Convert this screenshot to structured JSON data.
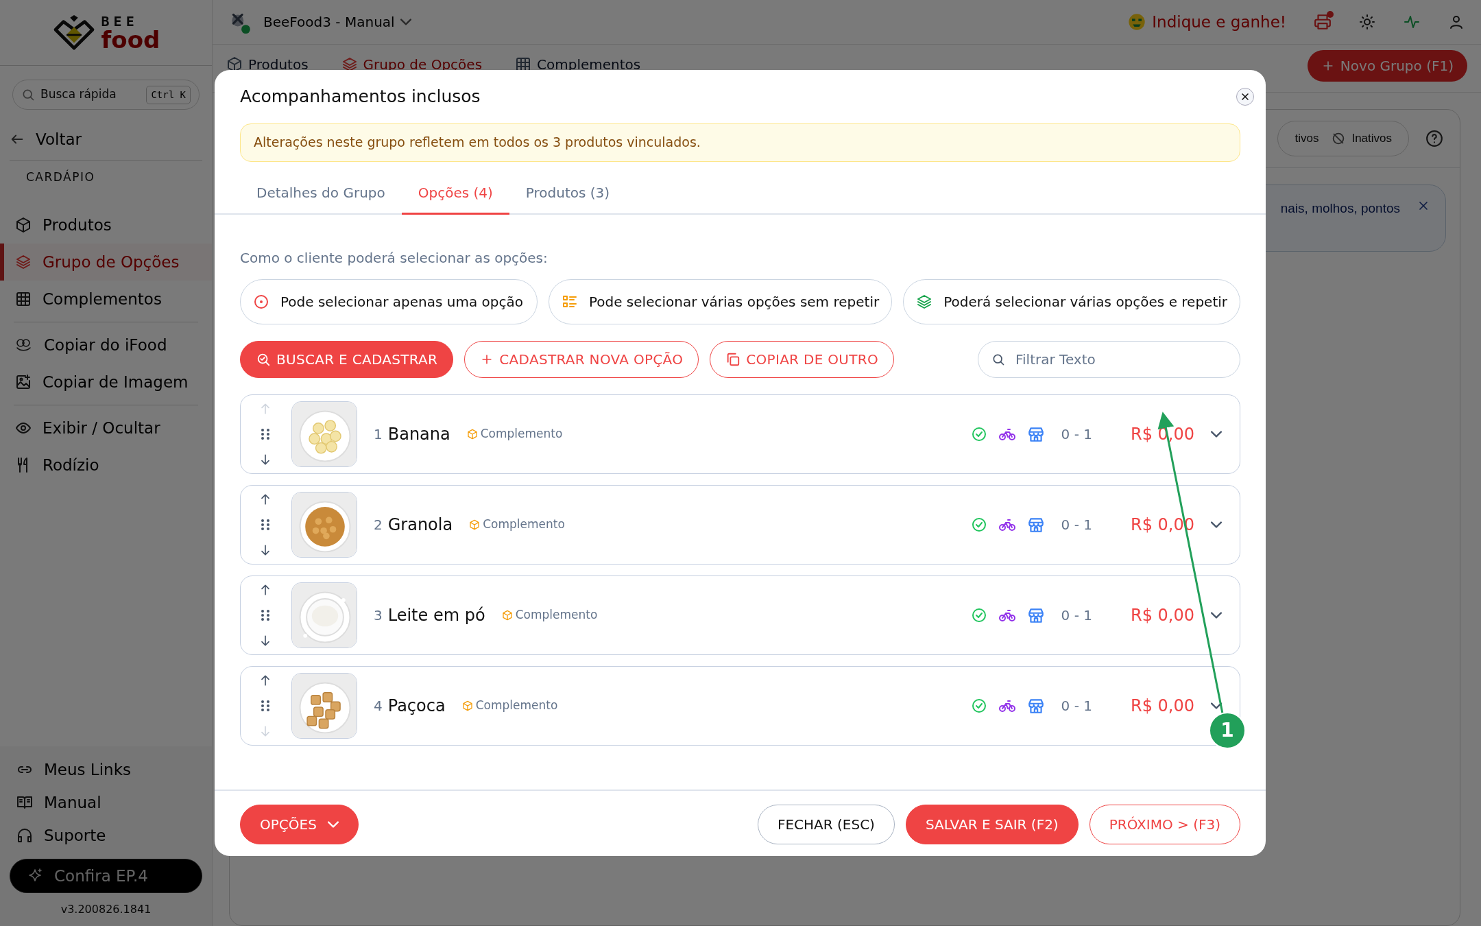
{
  "sidebar": {
    "logo": {
      "line1": "BEE",
      "line2": "food"
    },
    "search": {
      "placeholder": "Busca rápida",
      "shortcut": "Ctrl K"
    },
    "back": "Voltar",
    "section": "CARDÁPIO",
    "menu_groups": [
      {
        "items": [
          {
            "label": "Produtos",
            "selected": false
          },
          {
            "label": "Grupo de Opções",
            "selected": true
          },
          {
            "label": "Complementos",
            "selected": false
          }
        ]
      },
      {
        "items": [
          {
            "label": "Copiar do iFood",
            "selected": false
          },
          {
            "label": "Copiar de Imagem",
            "selected": false
          }
        ]
      },
      {
        "items": [
          {
            "label": "Exibir / Ocultar",
            "selected": false
          },
          {
            "label": "Rodízio",
            "selected": false
          }
        ]
      }
    ],
    "footer_links": [
      "Meus Links",
      "Manual",
      "Suporte"
    ],
    "promo_button": "Confira EP.4",
    "version": "v3.200826.1841"
  },
  "topbar": {
    "store": "BeeFood3 - Manual",
    "referral": "Indique e ganhe!",
    "printer_alert": true
  },
  "background": {
    "tabs": [
      {
        "label": "Produtos",
        "selected": false
      },
      {
        "label": "Grupo de Opções",
        "selected": true
      },
      {
        "label": "Complementos",
        "selected": false
      }
    ],
    "new_button": "Novo Grupo (F1)",
    "filters": [
      "tivos",
      "Inativos"
    ],
    "info_text": "nais, molhos, pontos"
  },
  "modal": {
    "title": "Acompanhamentos inclusos",
    "alert": "Alterações neste grupo refletem em todos os 3 produtos vinculados.",
    "tabs": [
      {
        "label": "Detalhes do Grupo",
        "selected": false
      },
      {
        "label": "Opções (4)",
        "selected": true
      },
      {
        "label": "Produtos (3)",
        "selected": false
      }
    ],
    "selection_label": "Como o cliente poderá selecionar as opções:",
    "modes": [
      "Pode selecionar apenas uma opção",
      "Pode selecionar várias opções sem repetir",
      "Poderá selecionar várias opções e repetir"
    ],
    "actions": [
      {
        "label": "BUSCAR E CADASTRAR",
        "kind": "primary"
      },
      {
        "label": "CADASTRAR NOVA OPÇÃO",
        "kind": "outline"
      },
      {
        "label": "COPIAR DE OUTRO",
        "kind": "outline"
      }
    ],
    "filter": {
      "placeholder": "Filtrar Texto"
    },
    "options": [
      {
        "number": "1",
        "name": "Banana",
        "tag": "Complemento",
        "range": "0 - 1",
        "price": "R$ 0,00",
        "up_disabled": true,
        "down_disabled": false
      },
      {
        "number": "2",
        "name": "Granola",
        "tag": "Complemento",
        "range": "0 - 1",
        "price": "R$ 0,00",
        "up_disabled": false,
        "down_disabled": false
      },
      {
        "number": "3",
        "name": "Leite em pó",
        "tag": "Complemento",
        "range": "0 - 1",
        "price": "R$ 0,00",
        "up_disabled": false,
        "down_disabled": false
      },
      {
        "number": "4",
        "name": "Paçoca",
        "tag": "Complemento",
        "range": "0 - 1",
        "price": "R$ 0,00",
        "up_disabled": false,
        "down_disabled": true
      }
    ],
    "footer": [
      {
        "label": "OPÇÕES",
        "kind": "dropdown"
      },
      {
        "label": "FECHAR (ESC)",
        "kind": "secondary"
      },
      {
        "label": "SALVAR E SAIR (F2)",
        "kind": "primary"
      },
      {
        "label": "PRÓXIMO > (F3)",
        "kind": "outline"
      }
    ]
  },
  "annotation": {
    "label": "1"
  }
}
